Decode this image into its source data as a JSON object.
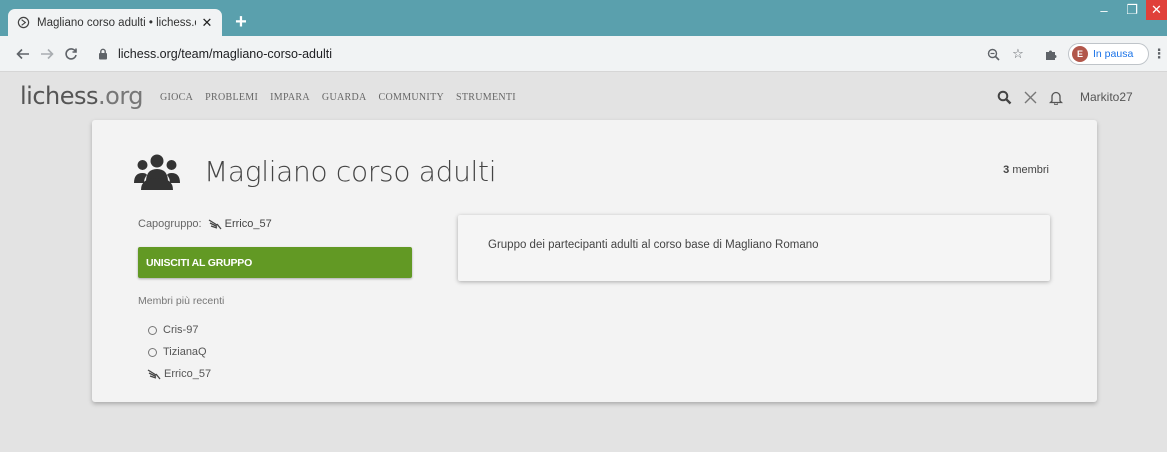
{
  "browser": {
    "tab_title": "Magliano corso adulti • lichess.o",
    "url": "lichess.org/team/magliano-corso-adulti",
    "profile_initial": "E",
    "profile_status": "In pausa"
  },
  "header": {
    "logo_main": "lichess",
    "logo_tld": ".org",
    "nav": [
      "GIOCA",
      "PROBLEMI",
      "IMPARA",
      "GUARDA",
      "COMMUNITY",
      "STRUMENTI"
    ],
    "username": "Markito27"
  },
  "team": {
    "name": "Magliano corso adulti",
    "members_count": "3",
    "members_label": "membri",
    "leader_label": "Capogruppo:",
    "leader_name": "Errico_57",
    "join_label": "UNISCITI AL GRUPPO",
    "recent_label": "Membri più recenti",
    "members": [
      {
        "name": "Cris-97",
        "icon": "offline-circle-icon"
      },
      {
        "name": "TizianaQ",
        "icon": "offline-circle-icon"
      },
      {
        "name": "Errico_57",
        "icon": "patron-wings-icon"
      }
    ],
    "description": "Gruppo dei partecipanti adulti al corso base di Magliano Romano"
  },
  "colors": {
    "tabstrip": "#5aa0ad",
    "join_button": "#629924",
    "close_button": "#e0403a"
  }
}
